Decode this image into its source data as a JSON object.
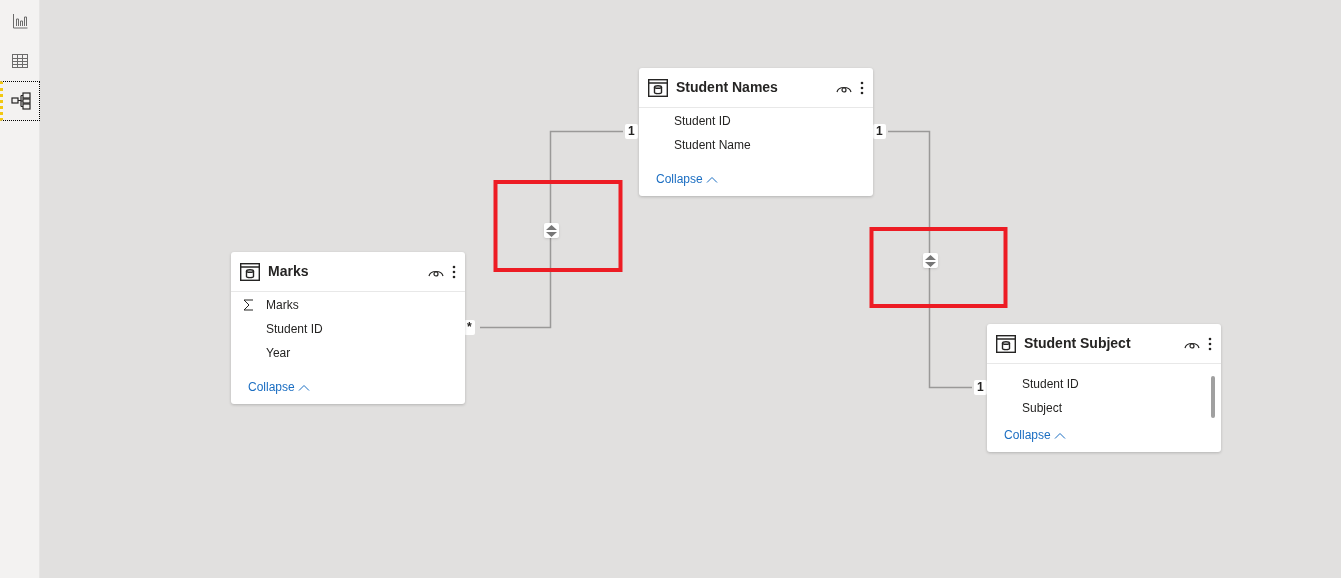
{
  "sidebar": {
    "items": [
      {
        "kind": "report",
        "selected": false
      },
      {
        "kind": "data",
        "selected": false
      },
      {
        "kind": "model",
        "selected": true
      }
    ]
  },
  "tables": [
    {
      "name": "Student Names",
      "fields": [
        {
          "name": "Student ID",
          "kind": "column"
        },
        {
          "name": "Student Name",
          "kind": "column"
        }
      ],
      "collapse": "Collapse"
    },
    {
      "name": "Marks",
      "fields": [
        {
          "name": "Marks",
          "kind": "measure"
        },
        {
          "name": "Student ID",
          "kind": "column"
        },
        {
          "name": "Year",
          "kind": "column"
        }
      ],
      "collapse": "Collapse"
    },
    {
      "name": "Student Subject",
      "fields": [
        {
          "name": "Student ID",
          "kind": "column"
        },
        {
          "name": "Subject",
          "kind": "column"
        }
      ],
      "collapse": "Collapse"
    }
  ],
  "relationships": [
    {
      "from_label": "*",
      "to_label": "1"
    },
    {
      "from_label": "1",
      "to_label": "1"
    }
  ]
}
